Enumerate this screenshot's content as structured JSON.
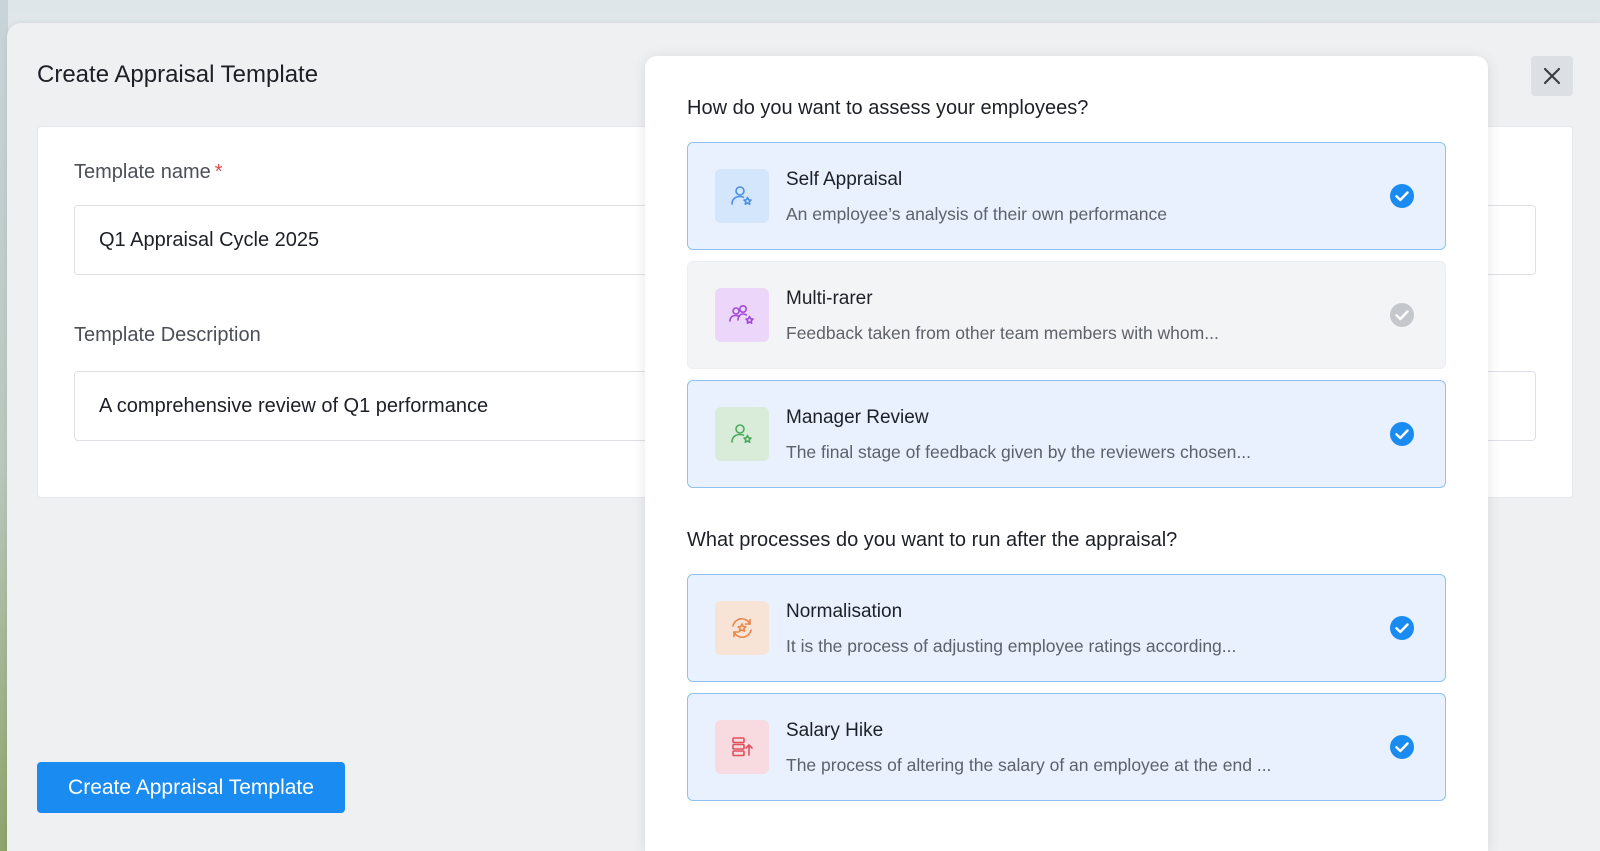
{
  "modal": {
    "title": "Create Appraisal Template",
    "close_icon": "close-icon"
  },
  "form": {
    "name_label": "Template name",
    "required_mark": "*",
    "name_value": "Q1 Appraisal Cycle 2025",
    "description_label": "Template Description",
    "description_value": "A comprehensive review of Q1 performance"
  },
  "submit_label": "Create Appraisal Template",
  "panel": {
    "assess_title": "How do you want to assess your employees?",
    "assess_options": [
      {
        "title": "Self Appraisal",
        "description": "An employee’s analysis of their own performance",
        "selected": true,
        "icon": "person-star-icon",
        "icon_color": "#4a8fe0",
        "icon_bg": "#d4e6fb"
      },
      {
        "title": "Multi-rarer",
        "description": "Feedback taken from other team members with whom...",
        "selected": false,
        "icon": "group-star-icon",
        "icon_color": "#a24ad8",
        "icon_bg": "#ecd7fa"
      },
      {
        "title": "Manager Review",
        "description": "The final stage of feedback given by the reviewers chosen...",
        "selected": true,
        "icon": "person-star-icon",
        "icon_color": "#4daa5a",
        "icon_bg": "#d8ecd9"
      }
    ],
    "process_title": "What processes do you want to run after the appraisal?",
    "process_options": [
      {
        "title": "Normalisation",
        "description": "It is the process of adjusting employee ratings according...",
        "selected": true,
        "icon": "cycle-star-icon",
        "icon_color": "#e8874a",
        "icon_bg": "#f8e4d6"
      },
      {
        "title": "Salary Hike",
        "description": "The process of altering the salary of an employee at the end ...",
        "selected": true,
        "icon": "money-stack-icon",
        "icon_color": "#e0505b",
        "icon_bg": "#f7dbe0"
      }
    ],
    "check_color": "#1a8bf0",
    "uncheck_color": "#c4c8cd"
  }
}
